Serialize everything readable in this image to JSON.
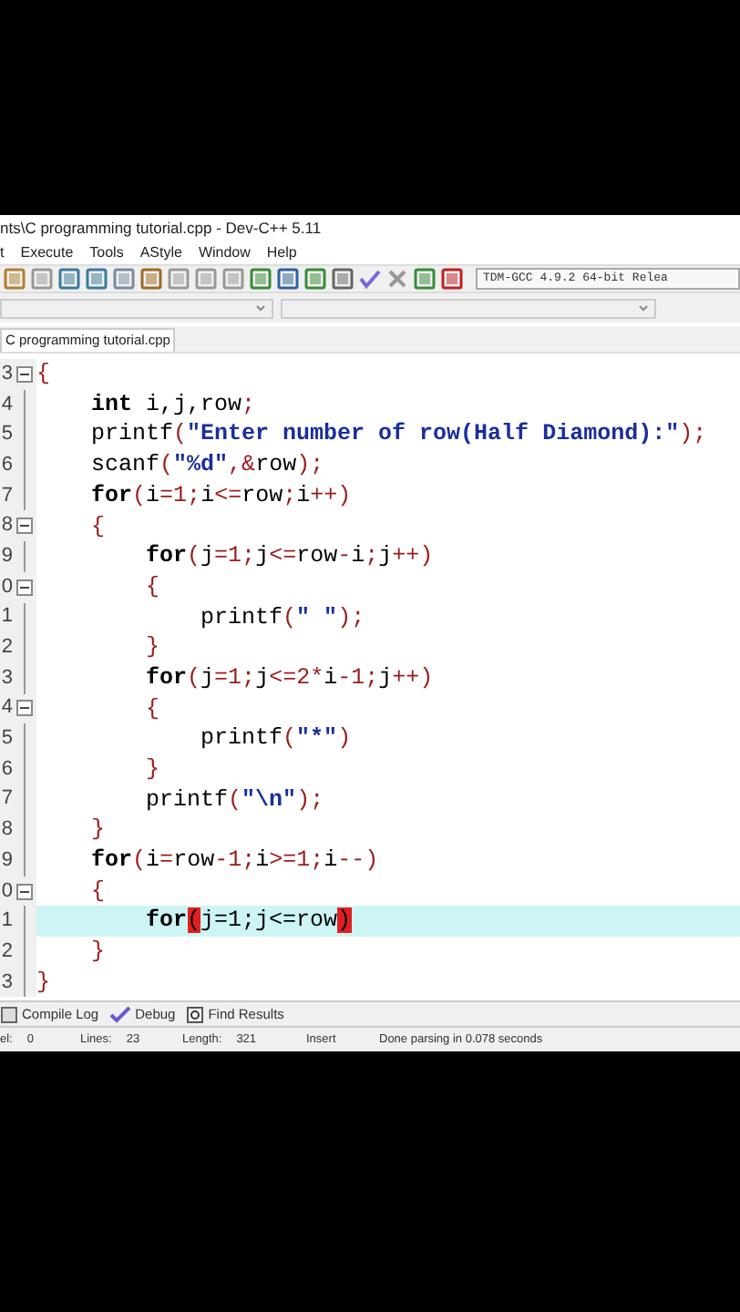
{
  "window": {
    "title": "nts\\C programming tutorial.cpp - Dev-C++ 5.11"
  },
  "menu": [
    "t",
    "Execute",
    "Tools",
    "AStyle",
    "Window",
    "Help"
  ],
  "compiler": {
    "value": "TDM-GCC 4.9.2 64-bit Relea"
  },
  "file_tab": {
    "label": "C programming tutorial.cpp",
    "selected": true
  },
  "editor": {
    "lines": [
      {
        "number": "3",
        "fold_start": true,
        "current": false,
        "tokens": [
          {
            "text": "{",
            "kind": "sym"
          }
        ]
      },
      {
        "number": "4",
        "fold_start": false,
        "current": false,
        "tokens": [
          {
            "text": "    int",
            "kind": "kw"
          },
          {
            "text": " i,j,row",
            "kind": "id"
          },
          {
            "text": ";",
            "kind": "sym"
          }
        ]
      },
      {
        "number": "5",
        "fold_start": false,
        "current": false,
        "tokens": [
          {
            "text": "    printf",
            "kind": "id"
          },
          {
            "text": "(",
            "kind": "sym"
          },
          {
            "text": "\"Enter number of row(Half Diamond):\"",
            "kind": "str"
          },
          {
            "text": ");",
            "kind": "sym"
          }
        ]
      },
      {
        "number": "6",
        "fold_start": false,
        "current": false,
        "tokens": [
          {
            "text": "    scanf",
            "kind": "id"
          },
          {
            "text": "(",
            "kind": "sym"
          },
          {
            "text": "\"%d\"",
            "kind": "str"
          },
          {
            "text": ",&",
            "kind": "sym"
          },
          {
            "text": "row",
            "kind": "id"
          },
          {
            "text": ");",
            "kind": "sym"
          }
        ]
      },
      {
        "number": "7",
        "fold_start": false,
        "current": false,
        "tokens": [
          {
            "text": "    for",
            "kind": "kw"
          },
          {
            "text": "(",
            "kind": "sym"
          },
          {
            "text": "i",
            "kind": "id"
          },
          {
            "text": "=1;",
            "kind": "sym"
          },
          {
            "text": "i",
            "kind": "id"
          },
          {
            "text": "<=",
            "kind": "sym"
          },
          {
            "text": "row",
            "kind": "id"
          },
          {
            "text": ";",
            "kind": "sym"
          },
          {
            "text": "i",
            "kind": "id"
          },
          {
            "text": "++)",
            "kind": "sym"
          }
        ]
      },
      {
        "number": "8",
        "fold_start": true,
        "current": false,
        "tokens": [
          {
            "text": "    {",
            "kind": "sym"
          }
        ]
      },
      {
        "number": "9",
        "fold_start": false,
        "current": false,
        "tokens": [
          {
            "text": "        for",
            "kind": "kw"
          },
          {
            "text": "(",
            "kind": "sym"
          },
          {
            "text": "j",
            "kind": "id"
          },
          {
            "text": "=1;",
            "kind": "sym"
          },
          {
            "text": "j",
            "kind": "id"
          },
          {
            "text": "<=",
            "kind": "sym"
          },
          {
            "text": "row",
            "kind": "id"
          },
          {
            "text": "-",
            "kind": "sym"
          },
          {
            "text": "i",
            "kind": "id"
          },
          {
            "text": ";",
            "kind": "sym"
          },
          {
            "text": "j",
            "kind": "id"
          },
          {
            "text": "++)",
            "kind": "sym"
          }
        ]
      },
      {
        "number": "0",
        "fold_start": true,
        "current": false,
        "tokens": [
          {
            "text": "        {",
            "kind": "sym"
          }
        ]
      },
      {
        "number": "1",
        "fold_start": false,
        "current": false,
        "tokens": [
          {
            "text": "            printf",
            "kind": "id"
          },
          {
            "text": "(",
            "kind": "sym"
          },
          {
            "text": "\" \"",
            "kind": "str"
          },
          {
            "text": ");",
            "kind": "sym"
          }
        ]
      },
      {
        "number": "2",
        "fold_start": false,
        "current": false,
        "tokens": [
          {
            "text": "        }",
            "kind": "sym"
          }
        ]
      },
      {
        "number": "3",
        "fold_start": false,
        "current": false,
        "tokens": [
          {
            "text": "        for",
            "kind": "kw"
          },
          {
            "text": "(",
            "kind": "sym"
          },
          {
            "text": "j",
            "kind": "id"
          },
          {
            "text": "=1;",
            "kind": "sym"
          },
          {
            "text": "j",
            "kind": "id"
          },
          {
            "text": "<=2*",
            "kind": "sym"
          },
          {
            "text": "i",
            "kind": "id"
          },
          {
            "text": "-1;",
            "kind": "sym"
          },
          {
            "text": "j",
            "kind": "id"
          },
          {
            "text": "++)",
            "kind": "sym"
          }
        ]
      },
      {
        "number": "4",
        "fold_start": true,
        "current": false,
        "tokens": [
          {
            "text": "        {",
            "kind": "sym"
          }
        ]
      },
      {
        "number": "5",
        "fold_start": false,
        "current": false,
        "tokens": [
          {
            "text": "            printf",
            "kind": "id"
          },
          {
            "text": "(",
            "kind": "sym"
          },
          {
            "text": "\"*\"",
            "kind": "str"
          },
          {
            "text": ")",
            "kind": "sym"
          }
        ]
      },
      {
        "number": "6",
        "fold_start": false,
        "current": false,
        "tokens": [
          {
            "text": "        }",
            "kind": "sym"
          }
        ]
      },
      {
        "number": "7",
        "fold_start": false,
        "current": false,
        "tokens": [
          {
            "text": "        printf",
            "kind": "id"
          },
          {
            "text": "(",
            "kind": "sym"
          },
          {
            "text": "\"\\n\"",
            "kind": "str"
          },
          {
            "text": ");",
            "kind": "sym"
          }
        ]
      },
      {
        "number": "8",
        "fold_start": false,
        "current": false,
        "tokens": [
          {
            "text": "    }",
            "kind": "sym"
          }
        ]
      },
      {
        "number": "9",
        "fold_start": false,
        "current": false,
        "tokens": [
          {
            "text": "    for",
            "kind": "kw"
          },
          {
            "text": "(",
            "kind": "sym"
          },
          {
            "text": "i",
            "kind": "id"
          },
          {
            "text": "=",
            "kind": "sym"
          },
          {
            "text": "row",
            "kind": "id"
          },
          {
            "text": "-1;",
            "kind": "sym"
          },
          {
            "text": "i",
            "kind": "id"
          },
          {
            "text": ">=1;",
            "kind": "sym"
          },
          {
            "text": "i",
            "kind": "id"
          },
          {
            "text": "--)",
            "kind": "sym"
          }
        ]
      },
      {
        "number": "0",
        "fold_start": true,
        "current": false,
        "tokens": [
          {
            "text": "    {",
            "kind": "sym"
          }
        ]
      },
      {
        "number": "1",
        "fold_start": false,
        "current": true,
        "tokens": [
          {
            "text": "        for",
            "kind": "kw"
          },
          {
            "text": "(",
            "kind": "match"
          },
          {
            "text": "j=1;j<=row",
            "kind": "id"
          },
          {
            "text": ")",
            "kind": "match"
          }
        ]
      },
      {
        "number": "2",
        "fold_start": false,
        "current": false,
        "tokens": [
          {
            "text": "    }",
            "kind": "sym"
          }
        ]
      },
      {
        "number": "3",
        "fold_start": false,
        "current": false,
        "tokens": [
          {
            "text": "}",
            "kind": "sym"
          }
        ]
      }
    ]
  },
  "bottom_tabs": [
    {
      "label": "Compile Log",
      "kind": "log"
    },
    {
      "label": "Debug",
      "kind": "debug"
    },
    {
      "label": "Find Results",
      "kind": "find"
    }
  ],
  "status_bar": [
    {
      "label": "el:",
      "value": "0"
    },
    {
      "label": "Lines:",
      "value": "23"
    },
    {
      "label": "Length:",
      "value": "321"
    },
    {
      "label": "Insert"
    },
    {
      "label": "Done parsing in 0.078 seconds"
    }
  ]
}
